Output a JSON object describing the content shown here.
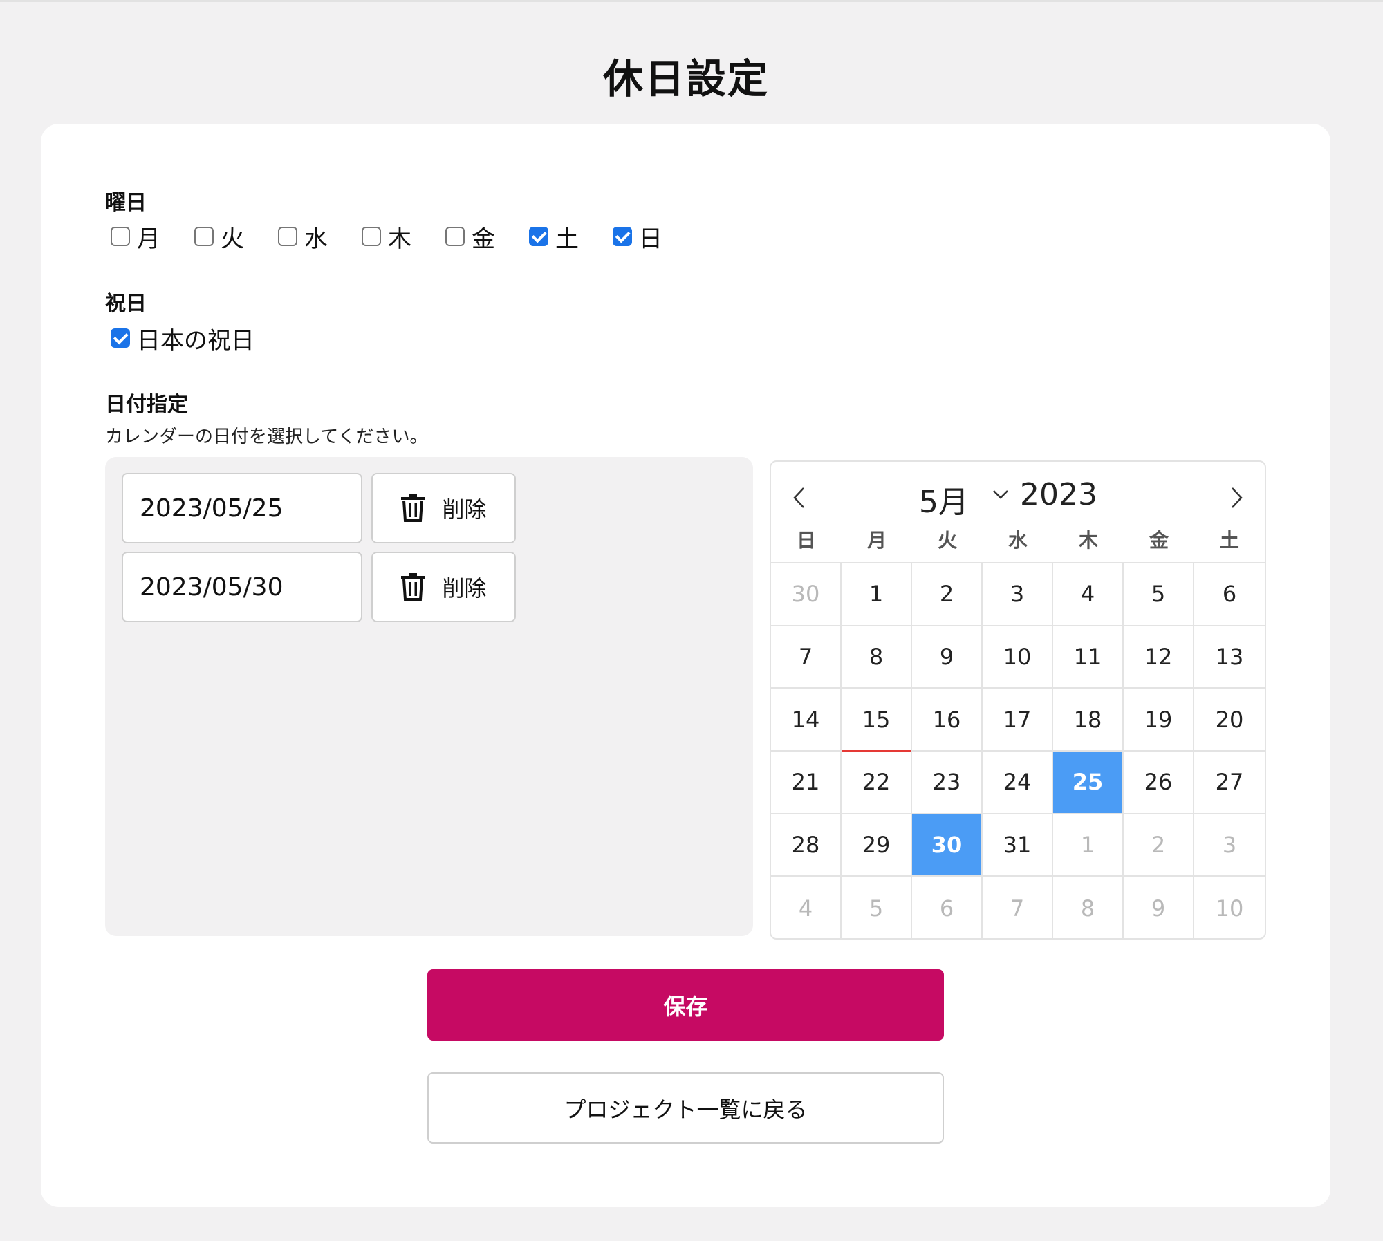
{
  "page": {
    "title": "休日設定"
  },
  "weekdays": {
    "label": "曜日",
    "items": [
      {
        "label": "月",
        "checked": false
      },
      {
        "label": "火",
        "checked": false
      },
      {
        "label": "水",
        "checked": false
      },
      {
        "label": "木",
        "checked": false
      },
      {
        "label": "金",
        "checked": false
      },
      {
        "label": "土",
        "checked": true
      },
      {
        "label": "日",
        "checked": true
      }
    ]
  },
  "holidays": {
    "label": "祝日",
    "items": [
      {
        "label": "日本の祝日",
        "checked": true
      }
    ]
  },
  "date_spec": {
    "label": "日付指定",
    "hint": "カレンダーの日付を選択してください。",
    "delete_label": "削除",
    "dates": [
      "2023/05/25",
      "2023/05/30"
    ]
  },
  "calendar": {
    "month": "5月",
    "year": "2023",
    "weekday_headers": [
      "日",
      "月",
      "火",
      "水",
      "木",
      "金",
      "土"
    ],
    "days": [
      {
        "d": "30",
        "muted": true
      },
      {
        "d": "1"
      },
      {
        "d": "2"
      },
      {
        "d": "3"
      },
      {
        "d": "4"
      },
      {
        "d": "5"
      },
      {
        "d": "6"
      },
      {
        "d": "7"
      },
      {
        "d": "8"
      },
      {
        "d": "9"
      },
      {
        "d": "10"
      },
      {
        "d": "11"
      },
      {
        "d": "12"
      },
      {
        "d": "13"
      },
      {
        "d": "14"
      },
      {
        "d": "15",
        "today": true
      },
      {
        "d": "16"
      },
      {
        "d": "17"
      },
      {
        "d": "18"
      },
      {
        "d": "19"
      },
      {
        "d": "20"
      },
      {
        "d": "21"
      },
      {
        "d": "22"
      },
      {
        "d": "23"
      },
      {
        "d": "24"
      },
      {
        "d": "25",
        "selected": true
      },
      {
        "d": "26"
      },
      {
        "d": "27"
      },
      {
        "d": "28"
      },
      {
        "d": "29"
      },
      {
        "d": "30",
        "selected": true
      },
      {
        "d": "31"
      },
      {
        "d": "1",
        "muted": true
      },
      {
        "d": "2",
        "muted": true
      },
      {
        "d": "3",
        "muted": true
      },
      {
        "d": "4",
        "muted": true
      },
      {
        "d": "5",
        "muted": true
      },
      {
        "d": "6",
        "muted": true
      },
      {
        "d": "7",
        "muted": true
      },
      {
        "d": "8",
        "muted": true
      },
      {
        "d": "9",
        "muted": true
      },
      {
        "d": "10",
        "muted": true
      }
    ]
  },
  "actions": {
    "save_label": "保存",
    "back_label": "プロジェクト一覧に戻る"
  },
  "colors": {
    "primary": "#c60a63",
    "selected_day": "#4b9cf5",
    "checkbox": "#1a73e8",
    "today_marker": "#e53935"
  }
}
